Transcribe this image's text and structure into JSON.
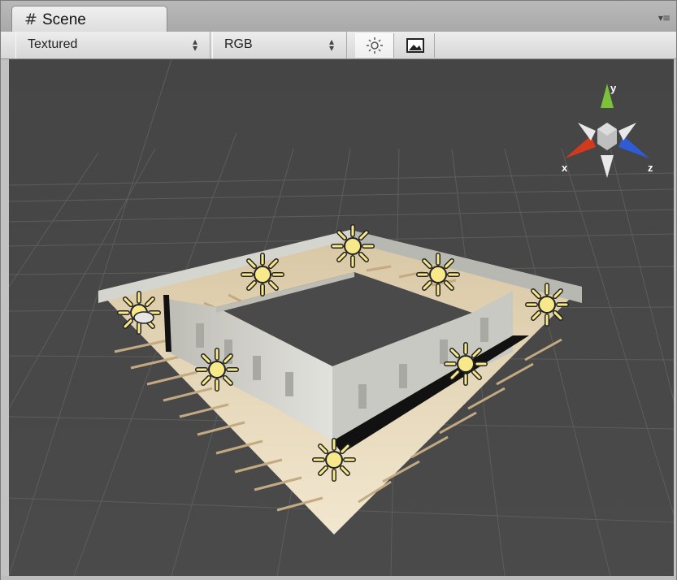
{
  "window": {
    "tab_title": "Scene",
    "tab_icon": "hash-icon",
    "tab_menu_glyph": "▾≡"
  },
  "toolbar": {
    "render_mode": "Textured",
    "color_mode": "RGB",
    "dropdown_arrows": "⬍",
    "lighting_button_icon": "sun-icon",
    "image_button_icon": "image-icon"
  },
  "gizmo": {
    "x_label": "x",
    "y_label": "y",
    "z_label": "z",
    "colors": {
      "x": "#d23a1f",
      "y": "#7bc23a",
      "z": "#2f5bd6",
      "neutral": "#e8e8e8"
    }
  },
  "scene": {
    "background_color": "#474747",
    "grid_color": "#5a5a5a",
    "floor_color": "#e9dcc0",
    "stripe_color": "#c2a882",
    "wall_color": "#cfcfcb",
    "light_color": "#f7e98a",
    "lights": [
      "point-light",
      "point-light",
      "point-light",
      "point-light",
      "point-light",
      "point-light",
      "point-light",
      "directional-light"
    ]
  }
}
